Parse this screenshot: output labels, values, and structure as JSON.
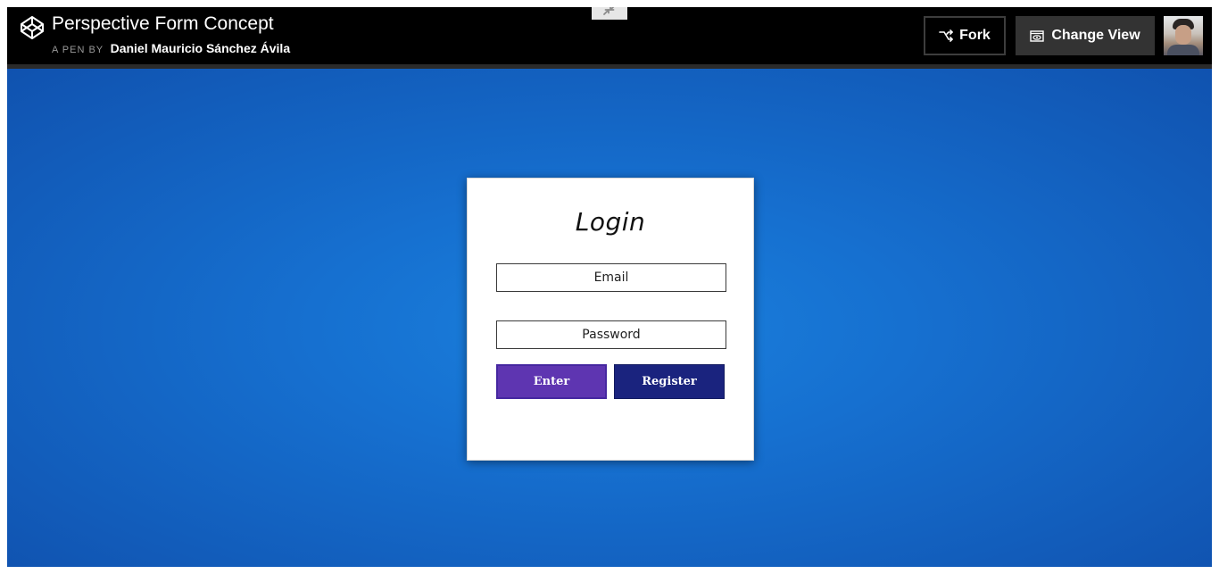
{
  "header": {
    "title": "Perspective Form Concept",
    "byline_prefix": "A PEN BY",
    "author": "Daniel Mauricio Sánchez Ávila",
    "fork_label": "Fork",
    "change_view_label": "Change View",
    "logo_icon": "codepen-logo-icon",
    "fork_icon": "fork-icon",
    "change_view_icon": "eye-window-icon",
    "collapse_icon": "collapse-arrows-icon"
  },
  "login": {
    "title": "Login",
    "email_placeholder": "Email",
    "email_value": "",
    "password_placeholder": "Password",
    "password_value": "",
    "enter_label": "Enter",
    "register_label": "Register"
  },
  "colors": {
    "header_bg": "#000000",
    "preview_bg_center": "#1a80dd",
    "preview_bg_edge": "#1052af",
    "enter_button": "#5e35b1",
    "register_button": "#1a237e"
  }
}
